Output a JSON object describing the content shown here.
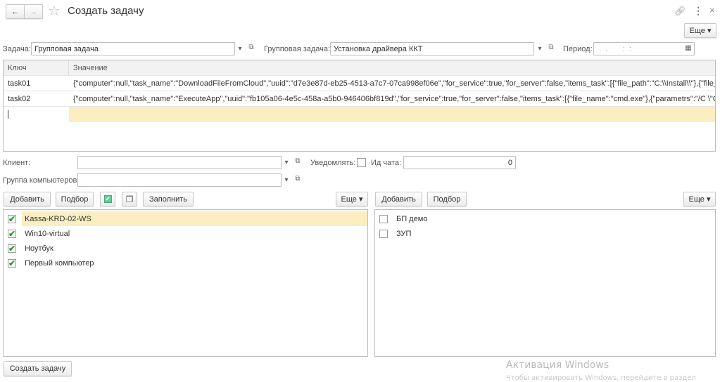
{
  "header": {
    "title": "Создать задачу",
    "back": "←",
    "forward": "→",
    "star": "☆",
    "link": "🔗",
    "menu": "⋮",
    "close": "×",
    "more": "Еще ▾"
  },
  "filters": {
    "task_label": "Задача:",
    "task_value": "Групповая задача",
    "group_task_label": "Групповая задача:",
    "group_task_value": "Установка драйвера ККТ",
    "period_label": "Период:",
    "period_value": " .  .       :  :"
  },
  "table": {
    "columns": [
      "Ключ",
      "Значение"
    ],
    "rows": [
      {
        "key": "task01",
        "value": "{\"computer\":null,\"task_name\":\"DownloadFileFromCloud\",\"uuid\":\"d7e3e87d-eb25-4513-a7c7-07ca998ef06e\",\"for_service\":true,\"for_server\":false,\"items_task\":[{\"file_path\":\"C:\\\\Install\\\\\"},{\"file_name\":\"..."
      },
      {
        "key": "task02",
        "value": "{\"computer\":null,\"task_name\":\"ExecuteApp\",\"uuid\":\"fb105a06-4e5c-458a-a5b0-946406bf819d\",\"for_service\":true,\"for_server\":false,\"items_task\":[{\"file_name\":\"cmd.exe\"},{\"parametrs\":\"/C \\\"C:\\\\Install..."
      }
    ]
  },
  "form": {
    "client_label": "Клиент:",
    "client_value": "",
    "notify_label": "Уведомлять:",
    "notify_checked": false,
    "chat_label": "Ид чата:",
    "chat_value": "0",
    "group_label": "Группа компьютеров:",
    "group_value": ""
  },
  "left_toolbar": {
    "add": "Добавить",
    "select": "Подбор",
    "fill": "Заполнить",
    "more": "Еще ▾"
  },
  "right_toolbar": {
    "add": "Добавить",
    "select": "Подбор",
    "more": "Еще ▾"
  },
  "computers": [
    {
      "name": "Kassa-KRD-02-WS",
      "checked": true
    },
    {
      "name": "Win10-virtual",
      "checked": true
    },
    {
      "name": "Ноутбук",
      "checked": true
    },
    {
      "name": "Первый компьютер",
      "checked": true
    }
  ],
  "bases": [
    {
      "name": "БП демо",
      "checked": false
    },
    {
      "name": "ЗУП",
      "checked": false
    }
  ],
  "footer": {
    "create": "Создать задачу"
  },
  "watermark": {
    "title": "Активация Windows",
    "text": "Чтобы активировать Windows, перейдите в раздел"
  },
  "colors": {
    "selected": "#fbeec0",
    "check": "#2a9a2a"
  }
}
